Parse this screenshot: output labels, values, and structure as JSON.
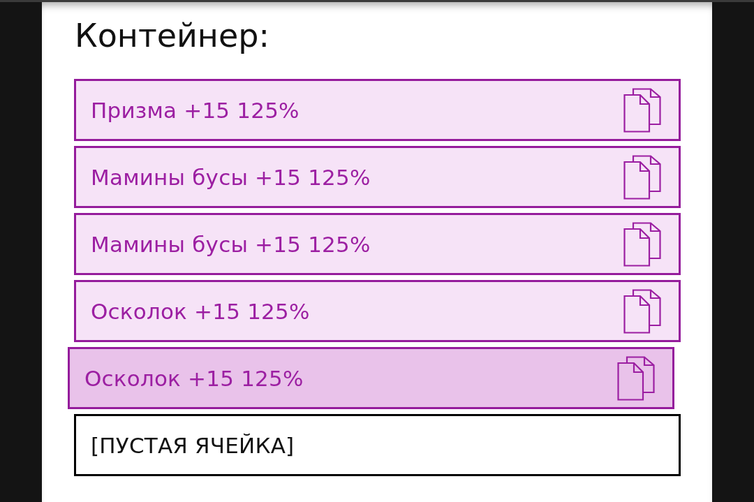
{
  "title": "Контейнер:",
  "slots": [
    {
      "kind": "item",
      "label": "Призма +15 125%",
      "dragging": false
    },
    {
      "kind": "item",
      "label": "Мамины бусы +15 125%",
      "dragging": false
    },
    {
      "kind": "item",
      "label": "Мамины бусы +15 125%",
      "dragging": false
    },
    {
      "kind": "item",
      "label": "Осколок +15 125%",
      "dragging": false
    },
    {
      "kind": "item",
      "label": "Осколок +15 125%",
      "dragging": true
    },
    {
      "kind": "empty",
      "label": "[ПУСТАЯ ЯЧЕЙКА]"
    }
  ]
}
